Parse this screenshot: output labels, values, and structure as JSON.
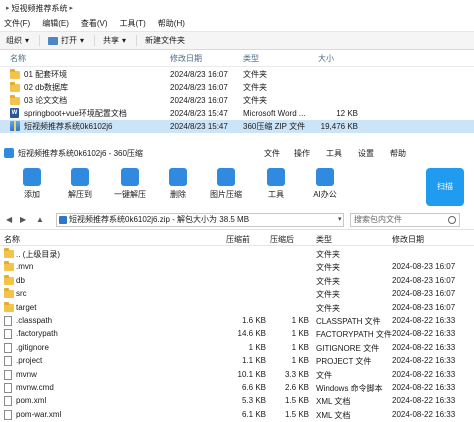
{
  "explorer": {
    "breadcrumb": "短视频推荐系统",
    "menu": [
      "文件(F)",
      "编辑(E)",
      "查看(V)",
      "工具(T)",
      "帮助(H)"
    ],
    "toolbar": {
      "organize": "组织",
      "open": "打开",
      "share": "共享",
      "new_folder": "新建文件夹"
    },
    "columns": {
      "name": "名称",
      "modified": "修改日期",
      "type": "类型",
      "size": "大小"
    },
    "rows": [
      {
        "name": "01 配套环境",
        "modified": "2024/8/23 16:07",
        "type": "文件夹",
        "size": "",
        "icon": "folder-icon"
      },
      {
        "name": "02 db数据库",
        "modified": "2024/8/23 16:07",
        "type": "文件夹",
        "size": "",
        "icon": "folder-icon"
      },
      {
        "name": "03 论文文档",
        "modified": "2024/8/23 16:07",
        "type": "文件夹",
        "size": "",
        "icon": "folder-icon"
      },
      {
        "name": "springboot+vue环境配置文档",
        "modified": "2024/8/23 15:47",
        "type": "Microsoft Word ...",
        "size": "12 KB",
        "icon": "word-icon"
      },
      {
        "name": "短视频推荐系统0k6102j6",
        "modified": "2024/8/23 15:47",
        "type": "360压缩 ZIP 文件",
        "size": "19,476 KB",
        "icon": "zip-icon",
        "selected": true
      }
    ]
  },
  "zip": {
    "title": "短视频推荐系统0k6102j6 - 360压缩",
    "menu": [
      "文件",
      "操作",
      "工具",
      "设置",
      "帮助"
    ],
    "ribbon": [
      "添加",
      "解压到",
      "一键解压",
      "删除",
      "图片压缩",
      "工具",
      "AI办公"
    ],
    "scan_label": "扫描",
    "path": "短视频推荐系统0k6102j6.zip - 解包大小为 38.5 MB",
    "search_placeholder": "搜索包内文件",
    "columns": {
      "name": "名称",
      "compressed": "压缩前",
      "original": "压缩后",
      "type": "类型",
      "modified": "修改日期"
    },
    "rows": [
      {
        "name": ".. (上级目录)",
        "compressed": "",
        "original": "",
        "type": "文件夹",
        "modified": "",
        "icon": "folder-icon"
      },
      {
        "name": ".mvn",
        "compressed": "",
        "original": "",
        "type": "文件夹",
        "modified": "2024-08-23 16:07",
        "icon": "folder-icon"
      },
      {
        "name": "db",
        "compressed": "",
        "original": "",
        "type": "文件夹",
        "modified": "2024-08-23 16:07",
        "icon": "folder-icon"
      },
      {
        "name": "src",
        "compressed": "",
        "original": "",
        "type": "文件夹",
        "modified": "2024-08-23 16:07",
        "icon": "folder-icon"
      },
      {
        "name": "target",
        "compressed": "",
        "original": "",
        "type": "文件夹",
        "modified": "2024-08-23 16:07",
        "icon": "folder-icon"
      },
      {
        "name": ".classpath",
        "compressed": "1.6 KB",
        "original": "1 KB",
        "type": "CLASSPATH 文件",
        "modified": "2024-08-22 16:33",
        "icon": "file-icon"
      },
      {
        "name": ".factorypath",
        "compressed": "14.6 KB",
        "original": "1 KB",
        "type": "FACTORYPATH 文件",
        "modified": "2024-08-22 16:33",
        "icon": "file-icon"
      },
      {
        "name": ".gitignore",
        "compressed": "1 KB",
        "original": "1 KB",
        "type": "GITIGNORE 文件",
        "modified": "2024-08-22 16:33",
        "icon": "file-icon"
      },
      {
        "name": ".project",
        "compressed": "1.1 KB",
        "original": "1 KB",
        "type": "PROJECT 文件",
        "modified": "2024-08-22 16:33",
        "icon": "file-icon"
      },
      {
        "name": "mvnw",
        "compressed": "10.1 KB",
        "original": "3.3 KB",
        "type": "文件",
        "modified": "2024-08-22 16:33",
        "icon": "file-icon"
      },
      {
        "name": "mvnw.cmd",
        "compressed": "6.6 KB",
        "original": "2.6 KB",
        "type": "Windows 命令脚本",
        "modified": "2024-08-22 16:33",
        "icon": "file-icon"
      },
      {
        "name": "pom.xml",
        "compressed": "5.3 KB",
        "original": "1.5 KB",
        "type": "XML 文档",
        "modified": "2024-08-22 16:33",
        "icon": "file-icon"
      },
      {
        "name": "pom-war.xml",
        "compressed": "6.1 KB",
        "original": "1.5 KB",
        "type": "XML 文档",
        "modified": "2024-08-22 16:33",
        "icon": "file-icon"
      }
    ]
  },
  "colors": {
    "accent": "#2f8ae0",
    "selection": "#cce4f7",
    "folder": "#f3c34c"
  }
}
